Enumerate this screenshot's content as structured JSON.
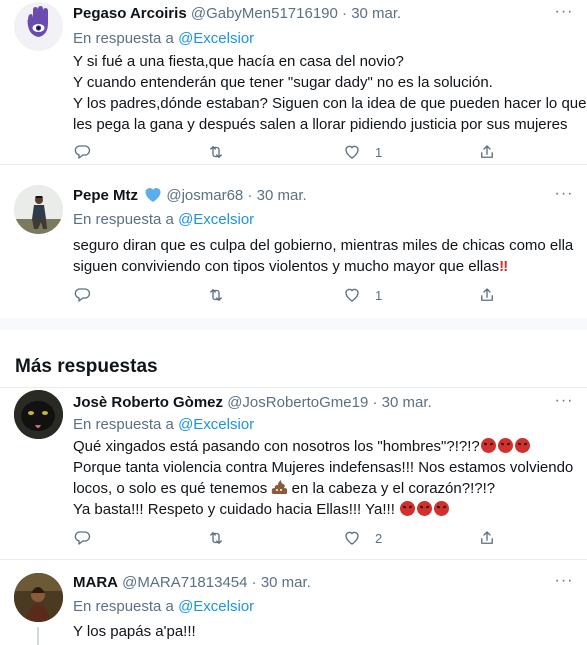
{
  "tweets": [
    {
      "name": "Pegaso Arcoiris",
      "handle": "@GabyMen51716190",
      "sep": "·",
      "date": "30 mar.",
      "reply_prefix": "En respuesta a",
      "reply_to": "@Excelsior",
      "lines": [
        "Y si fué a una fiesta,que hacía en casa del novio?",
        "Y cuando entenderán que tener \"sugar dady\" no es la solución.",
        "Y los padres,dónde estaban? Siguen con la idea de que pueden hacer lo que",
        "les pega la gana y después salen a llorar pidiendo justicia por sus mujeres"
      ],
      "likes": "1",
      "avatar_icon": "hamsa-icon"
    },
    {
      "name": "Pepe Mtz",
      "handle": "@josmar68",
      "sep": "·",
      "date": "30 mar.",
      "reply_prefix": "En respuesta a",
      "reply_to": "@Excelsior",
      "lines": [
        "seguro diran que es culpa del gobierno, mientras miles de chicas como ella",
        "siguen conviviendo con tipos violentos y mucho mayor que ellas"
      ],
      "line_suffix": "‼",
      "likes": "1",
      "badge_icon": "blue-heart-icon"
    },
    {
      "name": "Josè Roberto Gòmez",
      "handle": "@JosRobertoGme19",
      "sep": "·",
      "date": "30 mar.",
      "reply_prefix": "En respuesta a",
      "reply_to": "@Excelsior",
      "line1": "Qué xingados está pasando con nosotros los \"hombres\"?!?!?",
      "line2": "Porque tanta violencia contra Mujeres indefensas!!! Nos estamos volviendo",
      "line3a": "locos, o solo es qué tenemos",
      "line3b": "en la cabeza y el corazón?!?!?",
      "line4": "Ya basta!!! Respeto y cuidado hacia Ellas!!! Ya!!!",
      "likes": "2",
      "emoji_icon": "angry-face-icon",
      "poop_icon": "poop-icon"
    },
    {
      "name": "MARA",
      "handle": "@MARA71813454",
      "sep": "·",
      "date": "30 mar.",
      "reply_prefix": "En respuesta a",
      "reply_to": "@Excelsior",
      "line1": "Y los papás a'pa!!!"
    }
  ],
  "section_title": "Más respuestas",
  "more_glyph": "···",
  "colors": {
    "link": "#1b95e0",
    "muted": "#5b7083",
    "text": "#0f1419",
    "border": "#e6ecf0"
  }
}
